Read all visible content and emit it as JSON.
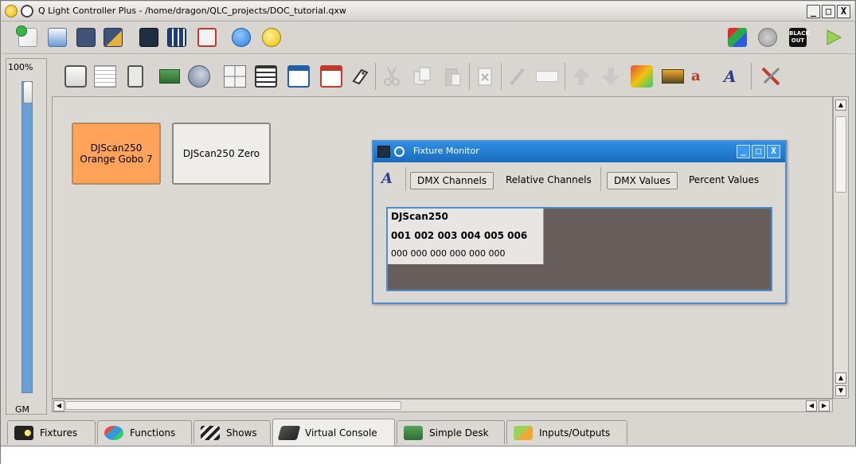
{
  "window": {
    "title": "Q Light Controller Plus - /home/dragon/QLC_projects/DOC_tutorial.qxw",
    "min_glyph": "_",
    "max_glyph": "□",
    "close_glyph": "X"
  },
  "main_toolbar": {
    "icons": [
      "new-project-icon",
      "open-icon",
      "save-icon",
      "save-as-icon",
      "monitor-icon",
      "address-tool-icon",
      "fullscreen-icon",
      "help-icon",
      "about-icon"
    ],
    "blackout_label": "BLACK OUT"
  },
  "grand_master": {
    "percent": "100%",
    "label": "GM",
    "value": 1.0
  },
  "vc_buttons": [
    {
      "label": "DJScan250\nOrange Gobo 7",
      "color": "#ffa35a",
      "active": true
    },
    {
      "label": "DJScan250 Zero",
      "color": "#efedeb",
      "active": false
    }
  ],
  "fixture_monitor": {
    "title": "Fixture Monitor",
    "tabs": [
      {
        "label": "DMX Channels",
        "checked": true
      },
      {
        "label": "Relative Channels",
        "checked": false
      },
      {
        "label": "DMX Values",
        "checked": true
      },
      {
        "label": "Percent Values",
        "checked": false
      }
    ],
    "fixture": {
      "name": "DJScan250",
      "channels": "001 002 003 004 005 006",
      "values": "000 000 000 000 000 000"
    }
  },
  "tabs": [
    {
      "label": "Fixtures",
      "icon": "fixtures-icon"
    },
    {
      "label": "Functions",
      "icon": "functions-icon"
    },
    {
      "label": "Shows",
      "icon": "shows-icon"
    },
    {
      "label": "Virtual Console",
      "icon": "virtual-console-icon",
      "active": true
    },
    {
      "label": "Simple Desk",
      "icon": "simple-desk-icon"
    },
    {
      "label": "Inputs/Outputs",
      "icon": "inputs-outputs-icon"
    }
  ],
  "colors": {
    "accent_blue": "#4d8fcf",
    "active_button": "#ffa35a",
    "monitor_bg": "#685f5c"
  }
}
